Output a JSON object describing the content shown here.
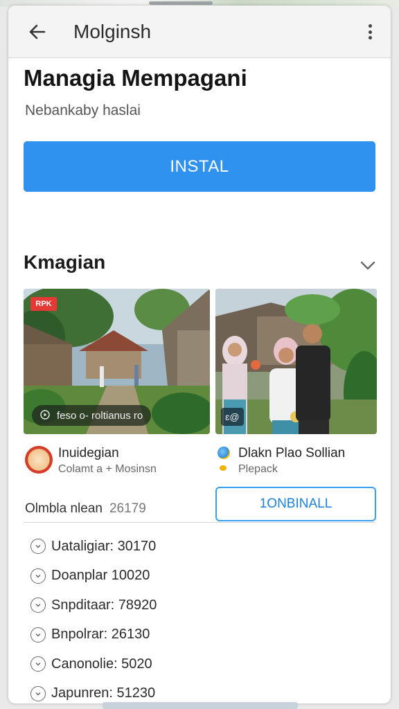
{
  "appbar": {
    "back_icon": "arrow-left-icon",
    "title": "Molginsh",
    "more_icon": "more-vert-icon"
  },
  "app": {
    "name": "Managia Mempagani",
    "developer": "Nebankaby haslai",
    "install_label": "INSTAL"
  },
  "section": {
    "title": "Kmagian",
    "chevron_icon": "chevron-down-icon"
  },
  "media": [
    {
      "badge": "RPK",
      "caption_icon": "play-icon",
      "caption": "feso o- roltianus ro"
    },
    {
      "chip": "ɛ@"
    }
  ],
  "related_apps": [
    {
      "title": "Inuidegian",
      "subtitle": "Colamt a + Mosinsn"
    },
    {
      "title": "Dlakn Plao Sollian",
      "subtitle": "Plepack"
    }
  ],
  "stat": {
    "label": "Olmbla nlean",
    "value": "26179"
  },
  "secondary_button_label": "1ONBINALL",
  "list": [
    {
      "label": "Uataligiar: 30170"
    },
    {
      "label": "Doanplar 10020"
    },
    {
      "label": "Snpditaar: 78920"
    },
    {
      "label": "Bnpolrar: 26130"
    },
    {
      "label": "Canonolie: 5020"
    },
    {
      "label": "Japunren: 51230"
    }
  ],
  "colors": {
    "accent": "#2f92ee",
    "outline_accent": "#3a9ef0",
    "badge_red": "#e53935"
  }
}
